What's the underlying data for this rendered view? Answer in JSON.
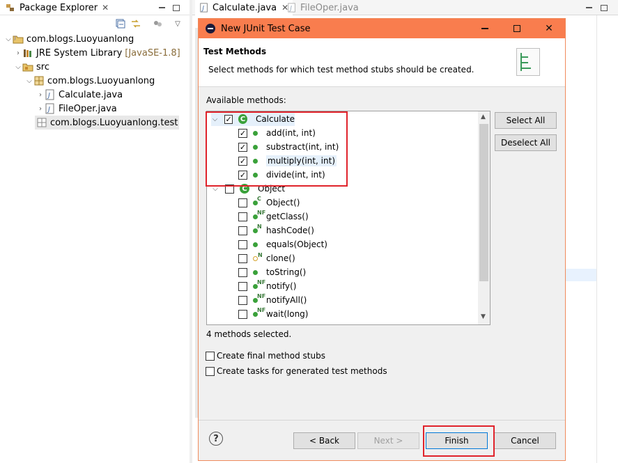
{
  "package_explorer": {
    "tab_label": "Package Explorer",
    "tree": [
      {
        "label": "com.blogs.Luoyuanlong",
        "suffix": ""
      },
      {
        "label": "JRE System Library",
        "suffix": "[JavaSE-1.8]"
      },
      {
        "label": "src",
        "suffix": ""
      },
      {
        "label": "com.blogs.Luoyuanlong",
        "suffix": ""
      },
      {
        "label": "Calculate.java",
        "suffix": ""
      },
      {
        "label": "FileOper.java",
        "suffix": ""
      },
      {
        "label": "com.blogs.Luoyuanlong.test",
        "suffix": ""
      }
    ]
  },
  "editor": {
    "tabs": [
      {
        "label": "Calculate.java"
      },
      {
        "label": "FileOper.java"
      }
    ]
  },
  "dialog": {
    "title": "New JUnit Test Case",
    "header_title": "Test Methods",
    "header_desc": "Select methods for which test method stubs should be created.",
    "available_label": "Available methods:",
    "methods": [
      {
        "label": "Calculate",
        "checked": true,
        "kind": "class"
      },
      {
        "label": "add(int, int)",
        "checked": true,
        "kind": "method"
      },
      {
        "label": "substract(int, int)",
        "checked": true,
        "kind": "method"
      },
      {
        "label": "multiply(int, int)",
        "checked": true,
        "kind": "method"
      },
      {
        "label": "divide(int, int)",
        "checked": true,
        "kind": "method"
      },
      {
        "label": "Object",
        "checked": false,
        "kind": "class"
      },
      {
        "label": "Object()",
        "checked": false,
        "kind": "method",
        "badge": "C"
      },
      {
        "label": "getClass()",
        "checked": false,
        "kind": "method",
        "badge": "NF"
      },
      {
        "label": "hashCode()",
        "checked": false,
        "kind": "method",
        "badge": "N"
      },
      {
        "label": "equals(Object)",
        "checked": false,
        "kind": "method"
      },
      {
        "label": "clone()",
        "checked": false,
        "kind": "protected",
        "badge": "N"
      },
      {
        "label": "toString()",
        "checked": false,
        "kind": "method"
      },
      {
        "label": "notify()",
        "checked": false,
        "kind": "method",
        "badge": "NF"
      },
      {
        "label": "notifyAll()",
        "checked": false,
        "kind": "method",
        "badge": "NF"
      },
      {
        "label": "wait(long)",
        "checked": false,
        "kind": "method",
        "badge": "NF"
      }
    ],
    "select_all": "Select All",
    "deselect_all": "Deselect All",
    "status": "4 methods selected.",
    "option_final_stubs": "Create final method stubs",
    "option_tasks": "Create tasks for generated test methods",
    "buttons": {
      "back": "< Back",
      "next": "Next >",
      "finish": "Finish",
      "cancel": "Cancel"
    },
    "help": "?"
  },
  "colors": {
    "title_bar": "#f97d4e",
    "highlight_box": "#e0232b",
    "method_icon": "#3aa13a"
  }
}
